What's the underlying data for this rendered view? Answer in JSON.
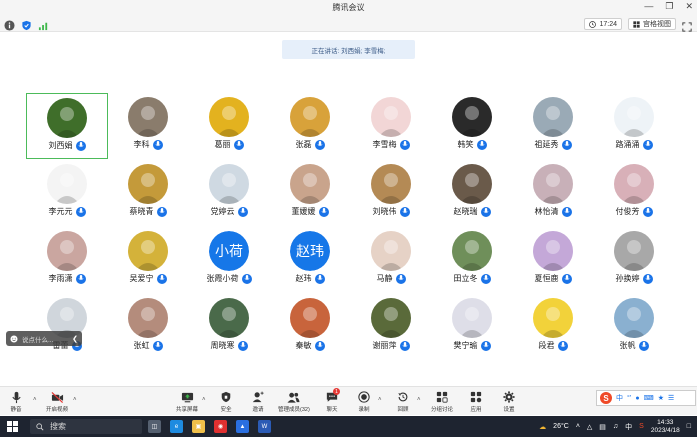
{
  "window": {
    "title": "腾讯会议"
  },
  "toolbar": {
    "timer": "17:24",
    "view_label": "宫格视图"
  },
  "speaking": {
    "text": "正在讲话: 刘西娟; 李雪梅;"
  },
  "participants": [
    {
      "name": "刘西娟",
      "active": true,
      "color": "#3f6e2a"
    },
    {
      "name": "李科",
      "color": "#8a7c6c"
    },
    {
      "name": "葛丽",
      "color": "#e3b21f"
    },
    {
      "name": "张磊",
      "color": "#d8a23a"
    },
    {
      "name": "李雪梅",
      "color": "#f2d6d6"
    },
    {
      "name": "韩笑",
      "color": "#2a2a2a"
    },
    {
      "name": "祖延秀",
      "color": "#9aaab6"
    },
    {
      "name": "路涌涌",
      "color": "#eef3f7"
    },
    {
      "name": "李元元",
      "color": "#f4f4f4"
    },
    {
      "name": "蔡晓青",
      "color": "#c49a3a"
    },
    {
      "name": "党婷云",
      "color": "#cfd9e2"
    },
    {
      "name": "董媛媛",
      "color": "#c9a48c"
    },
    {
      "name": "刘晓伟",
      "color": "#b48a55"
    },
    {
      "name": "赵晓瑞",
      "color": "#6a5a4a"
    },
    {
      "name": "林怡清",
      "color": "#c8b0b8"
    },
    {
      "name": "付俊芳",
      "color": "#d8b0b8"
    },
    {
      "name": "李雨潇",
      "color": "#caa6a0"
    },
    {
      "name": "吴爱宁",
      "color": "#d4b23a"
    },
    {
      "name": "张霞小荷",
      "text_avatar": "小荷"
    },
    {
      "name": "赵玮",
      "text_avatar": "赵玮"
    },
    {
      "name": "马静",
      "color": "#e6d2c6"
    },
    {
      "name": "田立冬",
      "color": "#6f8f5a"
    },
    {
      "name": "夏恒鹿",
      "color": "#c4a8d8"
    },
    {
      "name": "孙换婷",
      "color": "#a8a8a8"
    },
    {
      "name": "雷蕾",
      "color": "#d0d6dc"
    },
    {
      "name": "张虹",
      "color": "#b48c7c"
    },
    {
      "name": "周晓寒",
      "color": "#4a6a4a"
    },
    {
      "name": "秦敏",
      "color": "#c8643c"
    },
    {
      "name": "谢丽萍",
      "color": "#5a6a3a"
    },
    {
      "name": "樊宁瑜",
      "color": "#dedee8"
    },
    {
      "name": "段君",
      "color": "#f2d23a"
    },
    {
      "name": "张帆",
      "color": "#8ab0d0"
    }
  ],
  "chat": {
    "placeholder": "说点什么..."
  },
  "meeting_toolbar": {
    "mute": "静音",
    "video": "开启视频",
    "share": "共享屏幕",
    "security": "安全",
    "invite": "邀请",
    "members": "管理成员(32)",
    "chat": "聊天",
    "chat_badge": "1",
    "record": "录制",
    "rewind": "回顾",
    "breakout": "分组讨论",
    "apps": "应用",
    "settings": "设置"
  },
  "ime": {
    "lang": "中"
  },
  "taskbar": {
    "search": "搜索",
    "weather": "26°C",
    "ime": "中",
    "time": "14:33",
    "date": "2023/4/18"
  }
}
